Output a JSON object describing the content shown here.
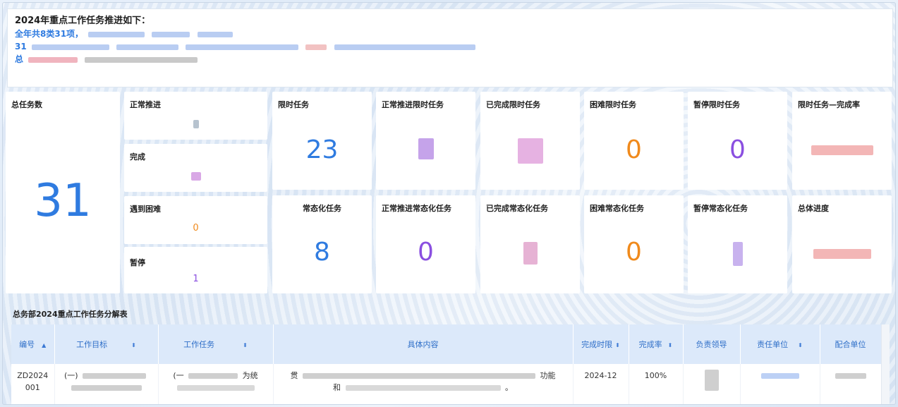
{
  "banner": {
    "title": "2024年重点工作任务推进如下：",
    "line1": "全年共8类31项，",
    "line2": "31",
    "line3": "总"
  },
  "stats": {
    "total": {
      "label": "总任务数",
      "value": "31"
    },
    "normal": {
      "label": "正常推进",
      "value": ""
    },
    "done": {
      "label": "完成",
      "value": ""
    },
    "difficulty": {
      "label": "遇到困难",
      "value": "0"
    },
    "paused": {
      "label": "暂停",
      "value": "1"
    },
    "timed": {
      "label": "限时任务",
      "value": "23"
    },
    "timed_normal": {
      "label": "正常推进限时任务",
      "value": ""
    },
    "timed_done": {
      "label": "已完成限时任务",
      "value": ""
    },
    "timed_difficult": {
      "label": "困难限时任务",
      "value": "0"
    },
    "timed_paused": {
      "label": "暂停限时任务",
      "value": "0"
    },
    "timed_rate": {
      "label": "限时任务—完成率",
      "value": ""
    },
    "routine": {
      "label": "常态化任务",
      "value": "8"
    },
    "routine_normal": {
      "label": "正常推进常态化任务",
      "value": "0"
    },
    "routine_done": {
      "label": "已完成常态化任务",
      "value": ""
    },
    "routine_difficult": {
      "label": "困难常态化任务",
      "value": "0"
    },
    "routine_paused": {
      "label": "暂停常态化任务",
      "value": ""
    },
    "overall": {
      "label": "总体进度",
      "value": ""
    }
  },
  "table": {
    "section_title": "总务部2024重点工作任务分解表",
    "headers": [
      "编号",
      "工作目标",
      "工作任务",
      "具体内容",
      "完成时限",
      "完成率",
      "负责领导",
      "责任单位",
      "配合单位"
    ],
    "rows": [
      {
        "id": "ZD2024001",
        "goal_line1": "(一)",
        "goal_line2": "",
        "task_line1": "(一",
        "task_suffix": "为统",
        "content_prefix": "贯",
        "content_suffix": "功能",
        "content_line2_prefix": "和",
        "content_line2_suffix": "。",
        "deadline": "2024-12",
        "rate": "100%"
      }
    ]
  },
  "colors": {
    "accent_blue": "#2f7be0",
    "orange": "#f08a1c",
    "purple": "#8a4fe0",
    "header_bg": "#dce9fa"
  }
}
